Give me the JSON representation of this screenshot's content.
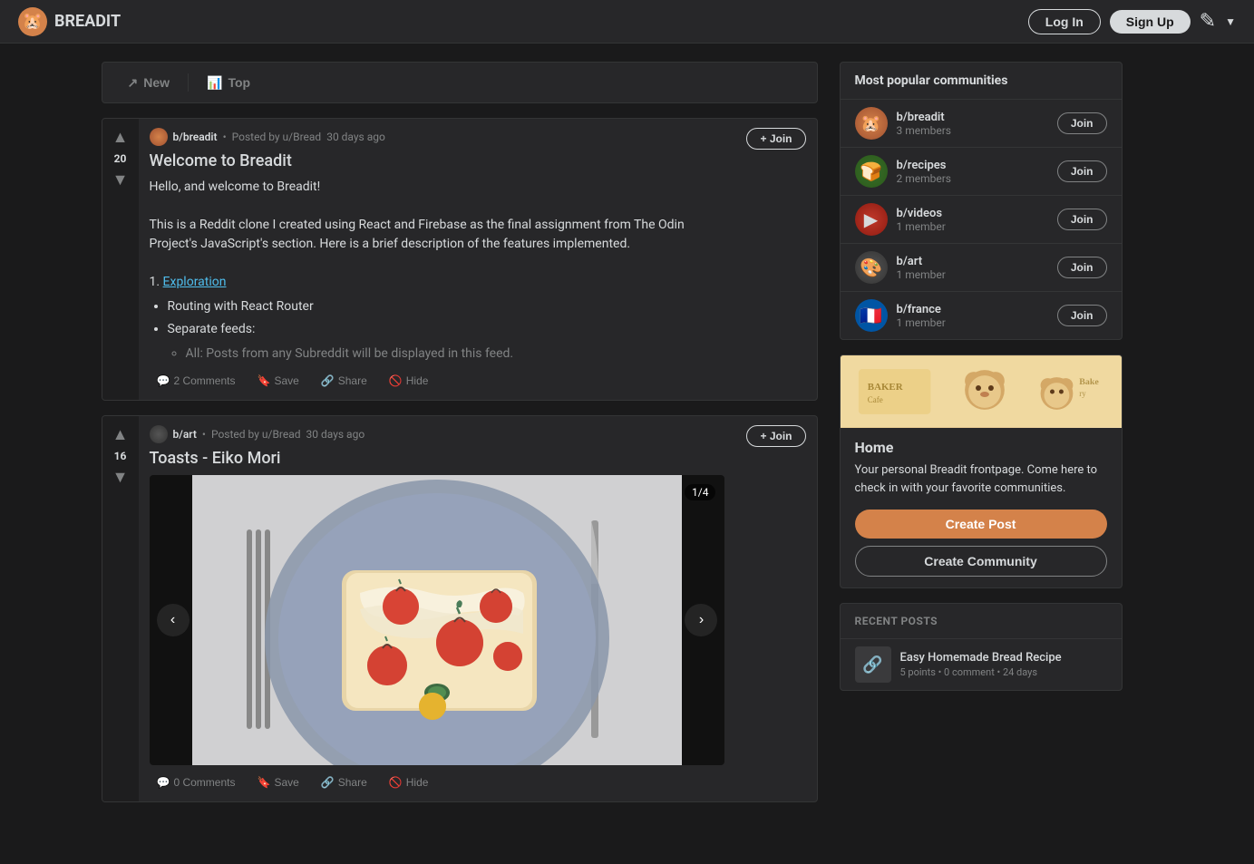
{
  "header": {
    "logo_emoji": "🐹",
    "site_name": "BREADIT",
    "login_label": "Log In",
    "signup_label": "Sign Up"
  },
  "sort_bar": {
    "new_label": "New",
    "top_label": "Top"
  },
  "posts": [
    {
      "id": "post-1",
      "community": "b/breadit",
      "posted_by": "u/Bread",
      "time_ago": "30 days ago",
      "vote_count": "20",
      "title": "Welcome to Breadit",
      "content_html": "Hello, and welcome to Breadit!\n\nThis is a Reddit clone I created using React and Firebase as the final assignment from The Odin Project's JavaScript's section. Here is a brief description of the features implemented.\n\n1. Exploration\n\n• Routing with React Router\n• Separate feeds:\n  ◦ All: Posts from any Subreddit will be displayed in this feed.",
      "exploration_link": "Exploration",
      "bullet1": "Routing with React Router",
      "bullet2": "Separate feeds:",
      "sub_bullet": "All: Posts from any Subreddit will be displayed in this feed.",
      "comments_count": "2 Comments",
      "save_label": "Save",
      "share_label": "Share",
      "hide_label": "Hide",
      "join_label": "+ Join",
      "has_image": false
    },
    {
      "id": "post-2",
      "community": "b/art",
      "posted_by": "u/Bread",
      "time_ago": "30 days ago",
      "vote_count": "16",
      "title": "Toasts - Eiko Mori",
      "comments_count": "0 Comments",
      "save_label": "Save",
      "share_label": "Share",
      "hide_label": "Hide",
      "join_label": "+ Join",
      "has_image": true,
      "carousel_counter": "1/4"
    }
  ],
  "sidebar": {
    "popular_communities_title": "Most popular communities",
    "communities": [
      {
        "name": "b/breadit",
        "members": "3 members",
        "icon_type": "breadit"
      },
      {
        "name": "b/recipes",
        "members": "2 members",
        "icon_type": "recipes"
      },
      {
        "name": "b/videos",
        "members": "1 member",
        "icon_type": "videos"
      },
      {
        "name": "b/art",
        "members": "1 member",
        "icon_type": "art"
      },
      {
        "name": "b/france",
        "members": "1 member",
        "icon_type": "france"
      }
    ],
    "join_label": "Join",
    "home_title": "Home",
    "home_desc": "Your personal Breadit frontpage. Come here to check in with your favorite communities.",
    "create_post_label": "Create Post",
    "create_community_label": "Create Community",
    "recent_posts_header": "RECENT POSTS",
    "recent_posts": [
      {
        "title": "Easy Homemade Bread Recipe",
        "meta": "5 points • 0 comment • 24 days"
      }
    ]
  }
}
